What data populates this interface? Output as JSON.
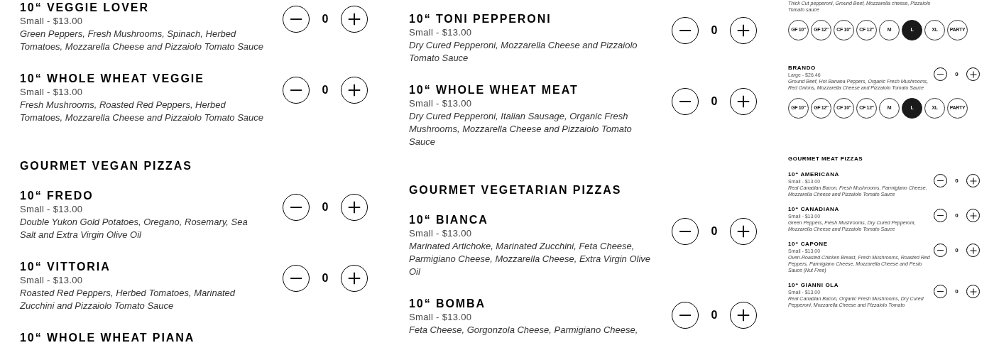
{
  "columns": [
    {
      "kind": "large",
      "entries": [
        {
          "kind": "item",
          "name": "10“ VEGGIE LOVER",
          "price": "Small - $13.00",
          "description": "Green Peppers, Fresh Mushrooms, Spinach, Herbed Tomatoes, Mozzarella Cheese and Pizzaiolo Tomato Sauce",
          "quantity": "0"
        },
        {
          "kind": "item",
          "name": "10“ WHOLE WHEAT VEGGIE",
          "price": "Small - $13.00",
          "description": "Fresh Mushrooms, Roasted Red Peppers, Herbed Tomatoes, Mozzarella Cheese and Pizzaiolo Tomato Sauce",
          "quantity": "0"
        },
        {
          "kind": "heading",
          "text": "GOURMET VEGAN PIZZAS"
        },
        {
          "kind": "item",
          "name": "10“ FREDO",
          "price": "Small - $13.00",
          "description": "Double Yukon Gold Potatoes, Oregano, Rosemary, Sea Salt and Extra Virgin Olive Oil",
          "quantity": "0"
        },
        {
          "kind": "item",
          "name": "10“ VITTORIA",
          "price": "Small - $13.00",
          "description": "Roasted Red Peppers, Herbed Tomatoes, Marinated Zucchini and Pizzaiolo Tomato Sauce",
          "quantity": "0"
        },
        {
          "kind": "item",
          "name": "10“ WHOLE WHEAT PIANA"
        }
      ]
    },
    {
      "kind": "large",
      "entries": [
        {
          "kind": "item",
          "name": "10“ TONI PEPPERONI",
          "price": "Small - $13.00",
          "description": "Dry Cured Pepperoni, Mozzarella Cheese and Pizzaiolo Tomato Sauce",
          "quantity": "0"
        },
        {
          "kind": "item",
          "name": "10“ WHOLE WHEAT MEAT",
          "price": "Small - $13.00",
          "description": "Dry Cured Pepperoni, Italian Sausage, Organic Fresh Mushrooms, Mozzarella Cheese and Pizzaiolo Tomato Sauce",
          "quantity": "0"
        },
        {
          "kind": "heading",
          "text": "GOURMET VEGETARIAN PIZZAS"
        },
        {
          "kind": "item",
          "name": "10“ BIANCA",
          "price": "Small - $13.00",
          "description": "Marinated Artichoke, Marinated Zucchini, Feta Cheese, Parmigiano Cheese, Mozzarella Cheese, Extra Virgin Olive Oil",
          "quantity": "0"
        },
        {
          "kind": "item",
          "name": "10“ BOMBA",
          "price": "Small - $13.00",
          "description": "Feta Cheese, Gorgonzola Cheese, Parmigiano Cheese,",
          "quantity": "0"
        }
      ]
    },
    {
      "kind": "compact",
      "entries": [
        {
          "kind": "item",
          "description": "Thick Cut pepperoni, Ground Beef, Mozzarella cheese, Pizzaiolo Tomato sauce",
          "sizes": [
            {
              "label": "GF 10\"",
              "selected": false
            },
            {
              "label": "GF 12\"",
              "selected": false
            },
            {
              "label": "CF 10\"",
              "selected": false
            },
            {
              "label": "CF 12\"",
              "selected": false
            },
            {
              "label": "M",
              "selected": false
            },
            {
              "label": "L",
              "selected": true
            },
            {
              "label": "XL",
              "selected": false
            },
            {
              "label": "PARTY",
              "selected": false
            }
          ]
        },
        {
          "kind": "item",
          "name": "BRANDO",
          "price": "Large - $26.46",
          "description": "Ground Beef, Hot Banana Peppers, Organic Fresh Mushrooms, Red Onions, Mozzarella Cheese and Pizzaiolo Tomato Sauce",
          "quantity": "0",
          "sizes": [
            {
              "label": "GF 10\"",
              "selected": false
            },
            {
              "label": "GF 12\"",
              "selected": false
            },
            {
              "label": "CF 10\"",
              "selected": false
            },
            {
              "label": "CF 12\"",
              "selected": false
            },
            {
              "label": "M",
              "selected": false
            },
            {
              "label": "L",
              "selected": true
            },
            {
              "label": "XL",
              "selected": false
            },
            {
              "label": "PARTY",
              "selected": false
            }
          ]
        },
        {
          "kind": "heading",
          "text": "GOURMET MEAT PIZZAS"
        },
        {
          "kind": "item",
          "name": "10“ AMERICANA",
          "price": "Small - $13.00",
          "description": "Real Canadian Bacon, Fresh Mushrooms, Parmigiano Cheese, Mozzarella Cheese and Pizzaiolo Tomato Sauce",
          "quantity": "0"
        },
        {
          "kind": "item",
          "name": "10“ CANADIANA",
          "price": "Small - $13.00",
          "description": "Green Peppers, Fresh Mushrooms, Dry Cured Pepperoni, Mozzarella Cheese and Pizzaiolo Tomato Sauce",
          "quantity": "0"
        },
        {
          "kind": "item",
          "name": "10“ CAPONE",
          "price": "Small - $13.00",
          "description": "Oven-Roasted Chicken Breast, Fresh Mushrooms, Roasted Red Peppers, Parmigiano Cheese, Mozzarella Cheese and Pesto Sauce (Nut Free)",
          "quantity": "0"
        },
        {
          "kind": "item",
          "name": "10“ GIANNI OLA",
          "price": "Small - $13.00",
          "description": "Real Canadian Bacon, Organic Fresh Mushrooms, Dry Cured Pepperoni, Mozzarella Cheese and Pizzaiolo Tomato",
          "quantity": "0"
        }
      ]
    }
  ]
}
